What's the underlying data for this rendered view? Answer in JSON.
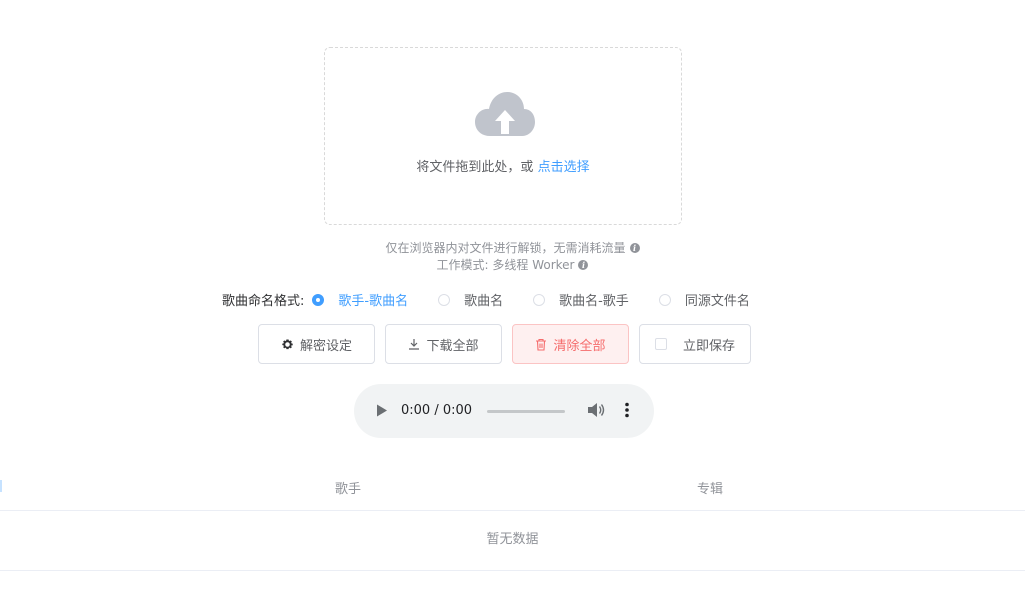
{
  "upload": {
    "drop_text": "将文件拖到此处，或",
    "select_link": "点击选择"
  },
  "hints": {
    "local_decrypt": "仅在浏览器内对文件进行解锁，无需消耗流量",
    "work_mode": "工作模式: 多线程 Worker"
  },
  "naming": {
    "label": "歌曲命名格式:",
    "selected": "歌手-歌曲名",
    "options": [
      "歌手-歌曲名",
      "歌曲名",
      "歌曲名-歌手",
      "同源文件名"
    ]
  },
  "buttons": {
    "decrypt_settings": "解密设定",
    "download_all": "下载全部",
    "clear_all": "清除全部",
    "save_now": "立即保存"
  },
  "player": {
    "time": "0:00 / 0:00"
  },
  "table": {
    "columns": [
      "歌手",
      "专辑"
    ],
    "empty_text": "暂无数据"
  },
  "colors": {
    "primary": "#409eff",
    "danger": "#f56c6c",
    "icon_gray": "#c0c4cc"
  }
}
